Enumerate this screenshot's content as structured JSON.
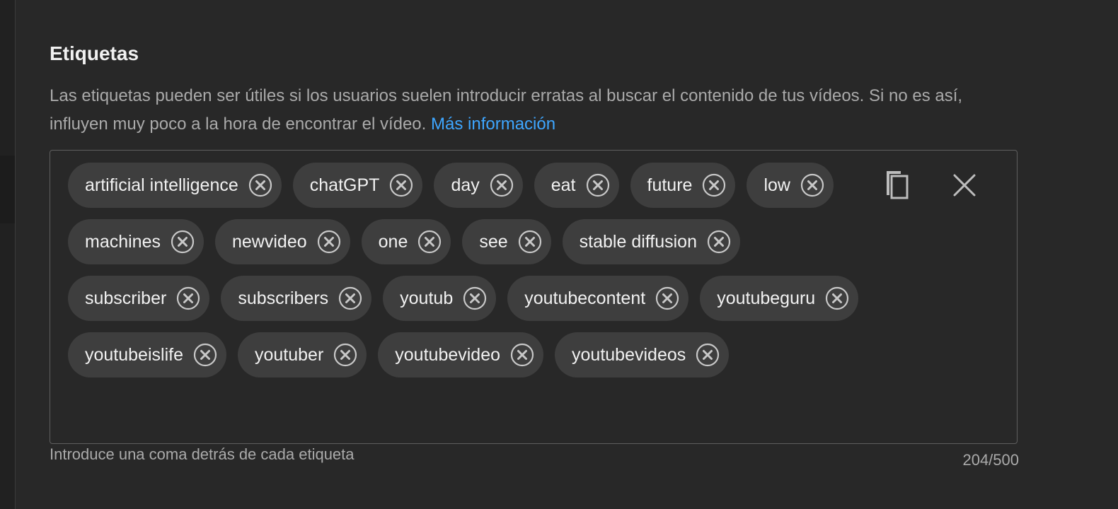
{
  "section": {
    "title": "Etiquetas",
    "description": "Las etiquetas pueden ser útiles si los usuarios suelen introducir erratas al buscar el contenido de tus vídeos. Si no es así, influyen muy poco a la hora de encontrar el vídeo.",
    "learn_more": "Más información"
  },
  "tags": [
    "artificial intelligence",
    "chatGPT",
    "day",
    "eat",
    "future",
    "low",
    "machines",
    "newvideo",
    "one",
    "see",
    "stable diffusion",
    "subscriber",
    "subscribers",
    "youtub",
    "youtubecontent",
    "youtubeguru",
    "youtubeislife",
    "youtuber",
    "youtubevideo",
    "youtubevideos"
  ],
  "actions": {
    "copy_icon": "copy-icon",
    "clear_icon": "close-icon",
    "chip_remove_icon": "remove-circle-icon"
  },
  "footer": {
    "hint": "Introduce una coma detrás de cada etiqueta",
    "counter": "204/500"
  },
  "colors": {
    "background": "#282828",
    "chip": "#3e3e3e",
    "link": "#3ea6ff",
    "text_primary": "#f1f1f1",
    "text_secondary": "#aaaaaa"
  }
}
